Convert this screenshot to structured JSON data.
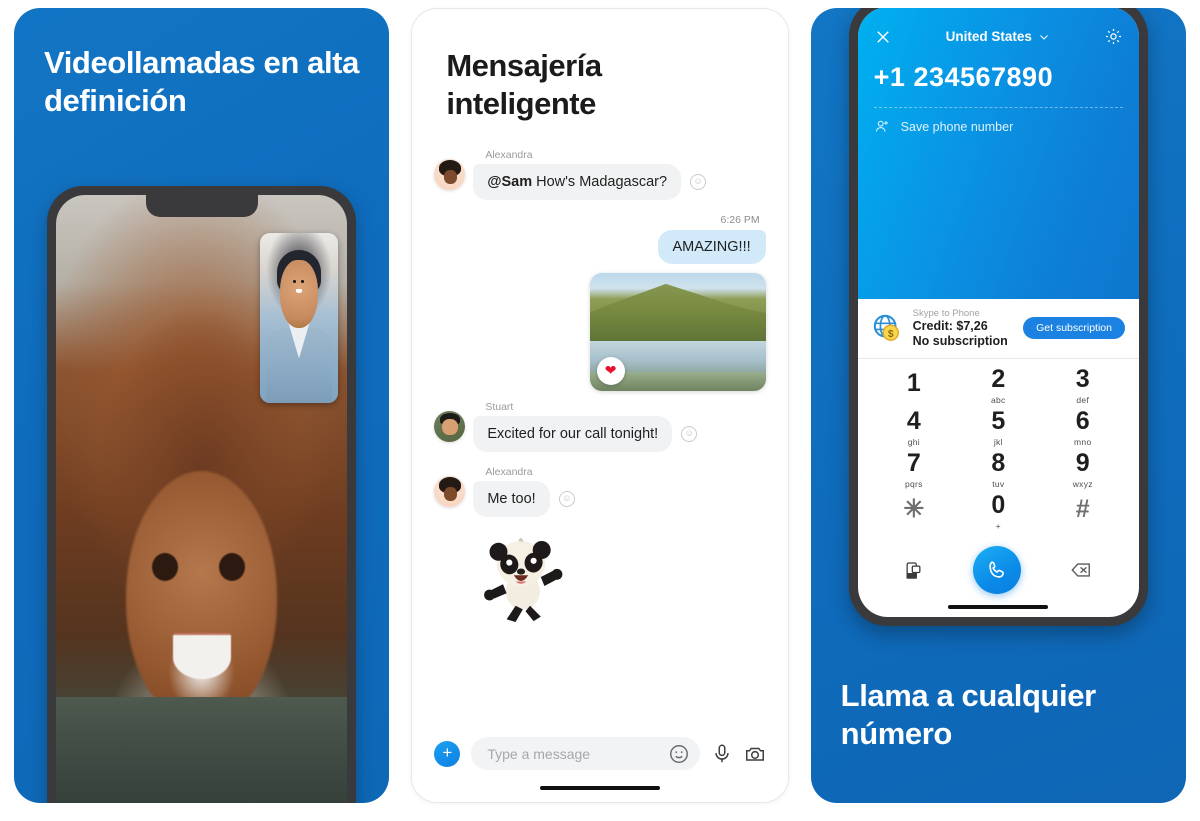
{
  "left_panel": {
    "caption": "Videollamadas en alta definición",
    "background_color": "#0f6cbd",
    "video_call": {
      "main_participant": "woman-smiling-curly-hair",
      "pip_participant": "man-smiling-blue-shirt"
    }
  },
  "middle_panel": {
    "title": "Mensajería inteligente",
    "messages": [
      {
        "id": "m1",
        "sender": "Alexandra",
        "direction": "incoming",
        "type": "text",
        "mention": "@Sam",
        "text": " How's Madagascar?",
        "reaction_icon": "smiley-outline-icon"
      },
      {
        "id": "m2",
        "sender": "",
        "direction": "outgoing",
        "type": "text",
        "time": "6:26 PM",
        "text": "AMAZING!!!",
        "bubble_color": "#d1e9f8"
      },
      {
        "id": "m3",
        "sender": "",
        "direction": "outgoing",
        "type": "photo",
        "alt": "landscape-hill-and-lake-photo",
        "reaction_emoji": "❤",
        "reaction_name": "heart-reaction"
      },
      {
        "id": "m4",
        "sender": "Stuart",
        "direction": "incoming",
        "type": "text",
        "text": "Excited for our call tonight!",
        "reaction_icon": "smiley-outline-icon"
      },
      {
        "id": "m5",
        "sender": "Alexandra",
        "direction": "incoming",
        "type": "text",
        "text": "Me too!",
        "reaction_icon": "smiley-outline-icon"
      },
      {
        "id": "m6",
        "sender": "Alexandra",
        "direction": "incoming",
        "type": "sticker",
        "sticker_name": "dancing-panda-sticker"
      }
    ],
    "composer": {
      "add_label": "+",
      "placeholder": "Type a message",
      "value": "",
      "emoji_icon": "smiley-icon",
      "mic_icon": "microphone-icon",
      "camera_icon": "camera-icon"
    }
  },
  "right_panel": {
    "caption": "Llama a cualquier número",
    "background_color": "#0f6cbd",
    "dialer": {
      "close_icon": "close-icon",
      "country": "United States",
      "country_chevron_icon": "chevron-down-icon",
      "settings_icon": "gear-icon",
      "phone_number": "+1 234567890",
      "save_icon": "add-contact-icon",
      "save_label": "Save phone number",
      "credit": {
        "service_label": "Skype to Phone",
        "credit_label": "Credit: $7,26",
        "subscription_label": "No subscription",
        "cta_label": "Get subscription",
        "cta_color": "#1b82e2",
        "globe_icon": "globe-coin-icon"
      },
      "keys": [
        {
          "digit": "1",
          "letters": ""
        },
        {
          "digit": "2",
          "letters": "abc"
        },
        {
          "digit": "3",
          "letters": "def"
        },
        {
          "digit": "4",
          "letters": "ghi"
        },
        {
          "digit": "5",
          "letters": "jkl"
        },
        {
          "digit": "6",
          "letters": "mno"
        },
        {
          "digit": "7",
          "letters": "pqrs"
        },
        {
          "digit": "8",
          "letters": "tuv"
        },
        {
          "digit": "9",
          "letters": "wxyz"
        },
        {
          "digit": "✳",
          "letters": ""
        },
        {
          "digit": "0",
          "letters": "+"
        },
        {
          "digit": "#",
          "letters": ""
        }
      ],
      "actions": {
        "contacts_icon": "phone-contacts-icon",
        "call_icon": "phone-call-icon",
        "backspace_icon": "backspace-icon"
      }
    }
  }
}
